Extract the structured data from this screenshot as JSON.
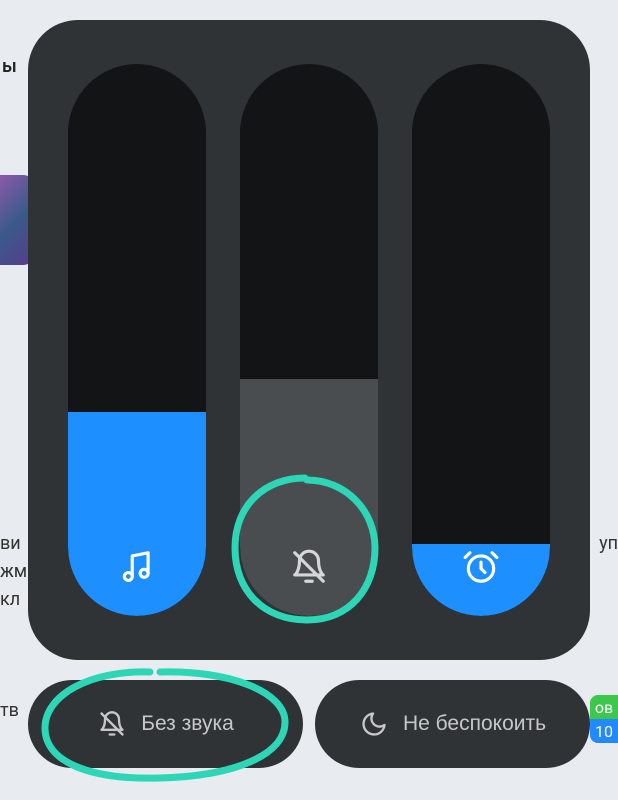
{
  "sliders": {
    "media": {
      "fill_percent": 37,
      "icon": "music-note-icon",
      "color": "#1e8fff"
    },
    "ring": {
      "fill_percent": 43,
      "icon": "bell-off-icon",
      "color": "#4a4d50"
    },
    "alarm": {
      "fill_percent": 13,
      "icon": "alarm-clock-icon",
      "color": "#1e8fff"
    }
  },
  "buttons": {
    "mute": {
      "label": "Без звука",
      "icon": "bell-off-icon"
    },
    "dnd": {
      "label": "Не беспокоить",
      "icon": "moon-icon"
    }
  },
  "background_hints": {
    "top_left_char": "ы",
    "lines_left": "ви\nжм\nкл",
    "lines_right": "уп",
    "pill_left": "тв",
    "pill_right_top": "ов",
    "pill_right_bottom": "10"
  },
  "colors": {
    "panel_bg": "#303336",
    "slider_bg": "#131416",
    "accent_blue": "#1e8fff",
    "muted_fill": "#4a4d50",
    "text": "#c5c7ca",
    "annotation": "#2dd6b7"
  }
}
